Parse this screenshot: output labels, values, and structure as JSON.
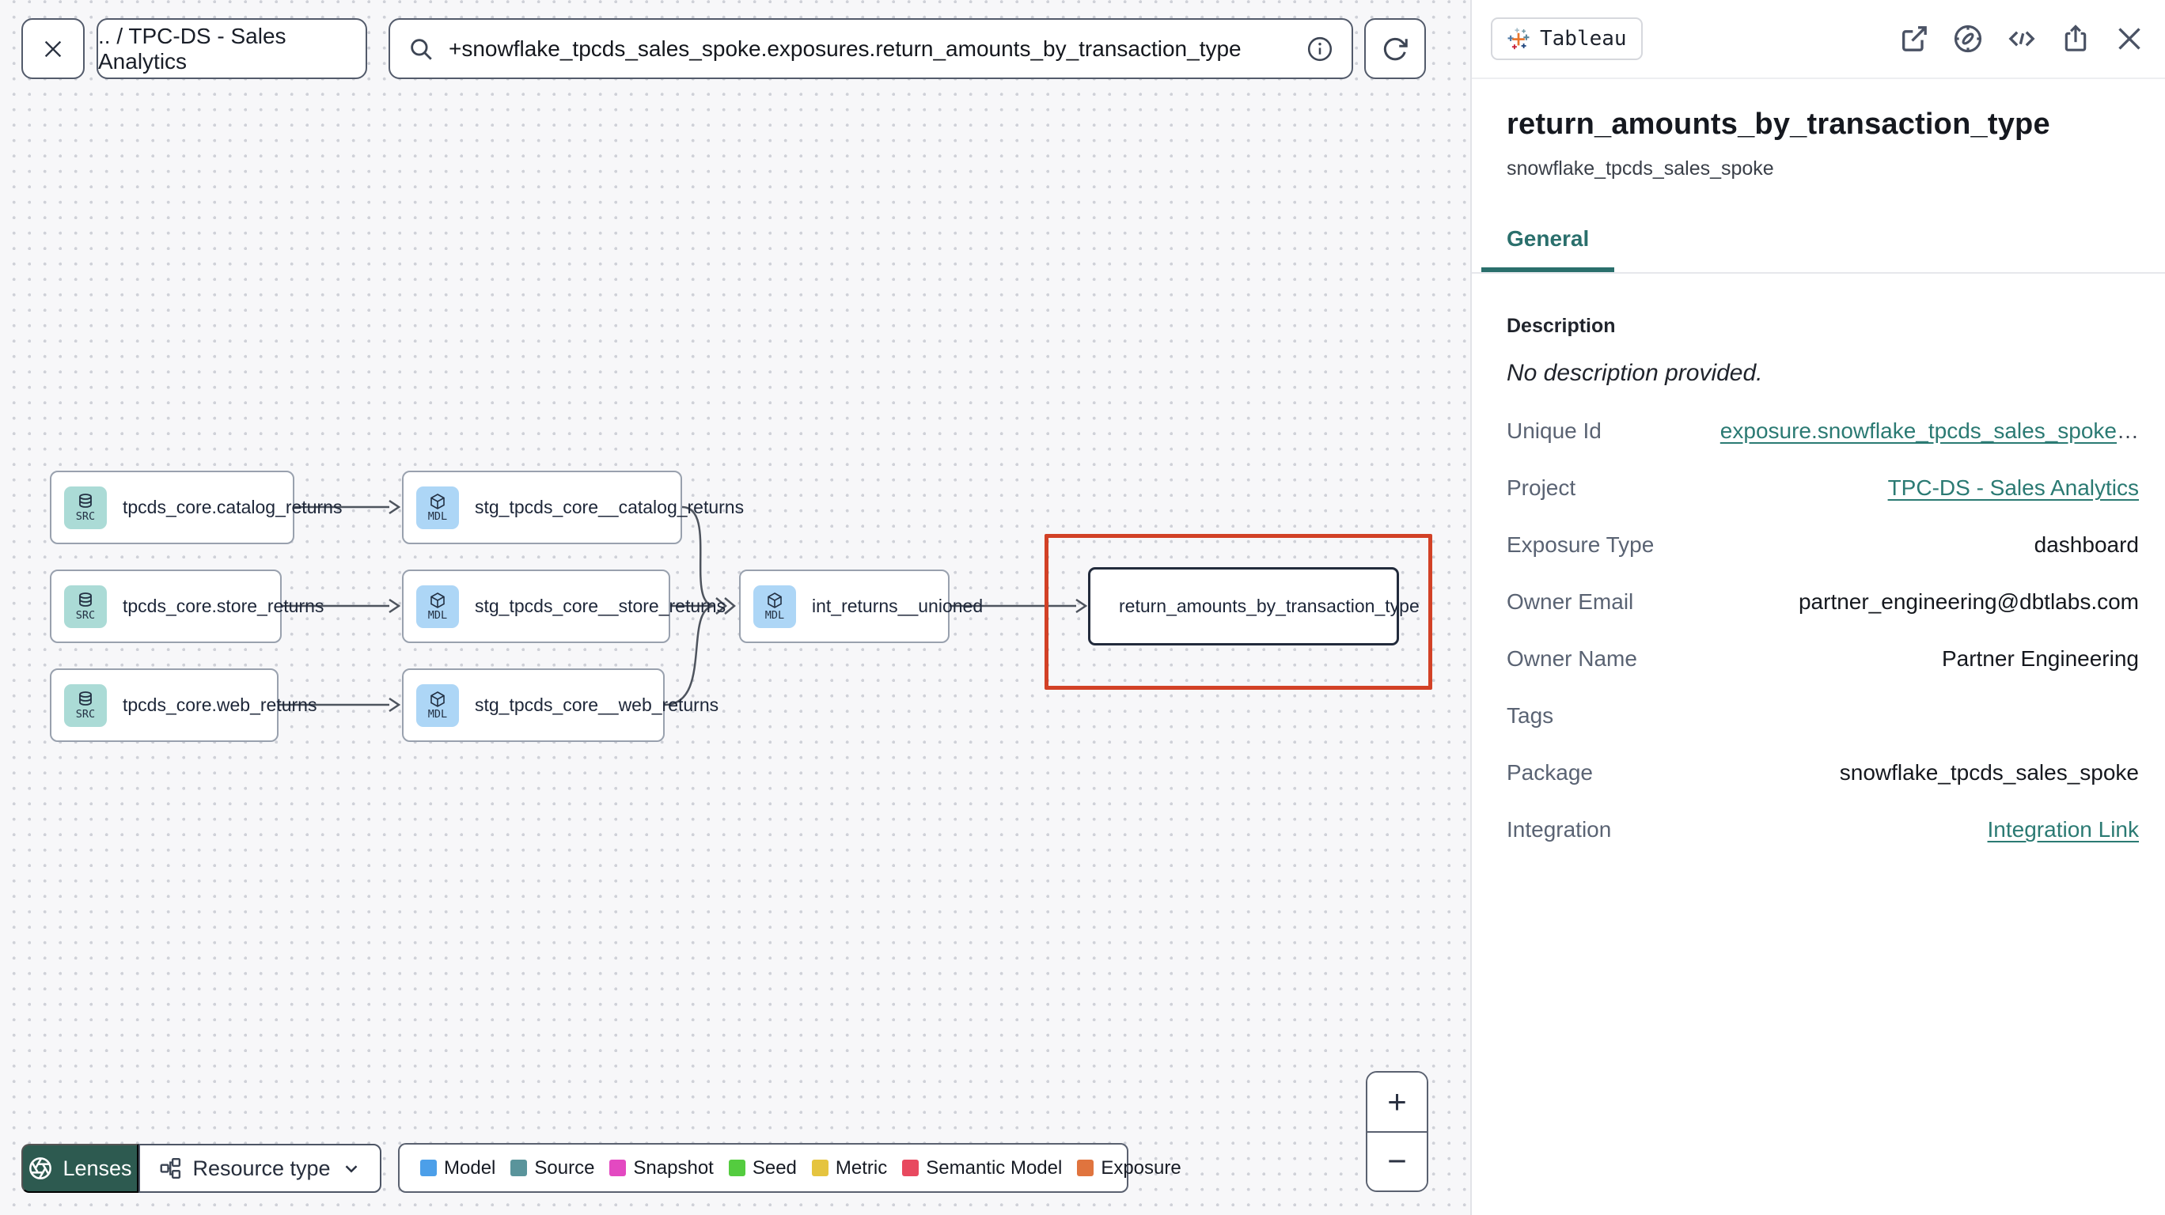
{
  "topbar": {
    "breadcrumb": ".. / TPC-DS - Sales Analytics",
    "search_value": "+snowflake_tpcds_sales_spoke.exposures.return_amounts_by_transaction_type"
  },
  "graph": {
    "nodes": [
      {
        "label": "tpcds_core.catalog_returns",
        "badge": "SRC",
        "type": "source"
      },
      {
        "label": "tpcds_core.store_returns",
        "badge": "SRC",
        "type": "source"
      },
      {
        "label": "tpcds_core.web_returns",
        "badge": "SRC",
        "type": "source"
      },
      {
        "label": "stg_tpcds_core__catalog_returns",
        "badge": "MDL",
        "type": "model"
      },
      {
        "label": "stg_tpcds_core__store_returns",
        "badge": "MDL",
        "type": "model"
      },
      {
        "label": "stg_tpcds_core__web_returns",
        "badge": "MDL",
        "type": "model"
      },
      {
        "label": "int_returns__unioned",
        "badge": "MDL",
        "type": "model"
      },
      {
        "label": "return_amounts_by_transaction_type",
        "type": "exposure"
      }
    ]
  },
  "toolbar": {
    "lenses_label": "Lenses",
    "resource_type_label": "Resource type"
  },
  "legend": {
    "items": [
      {
        "label": "Model",
        "color": "#4C9FE9"
      },
      {
        "label": "Source",
        "color": "#5A949B"
      },
      {
        "label": "Snapshot",
        "color": "#E349C1"
      },
      {
        "label": "Seed",
        "color": "#54CC3F"
      },
      {
        "label": "Metric",
        "color": "#E5C43F"
      },
      {
        "label": "Semantic Model",
        "color": "#E8495F"
      },
      {
        "label": "Exposure",
        "color": "#E0743E"
      }
    ]
  },
  "zoom_controls": {
    "zoom_in": "+",
    "zoom_out": "−"
  },
  "panel": {
    "integration_badge": "Tableau",
    "title": "return_amounts_by_transaction_type",
    "subtitle": "snowflake_tpcds_sales_spoke",
    "tab_general": "General",
    "description_label": "Description",
    "description_value": "No description provided.",
    "unique_id_ellipsis": "…",
    "fields": [
      {
        "label": "Unique Id",
        "value": "exposure.snowflake_tpcds_sales_spoke"
      },
      {
        "label": "Project",
        "value": "TPC-DS - Sales Analytics"
      },
      {
        "label": "Exposure Type",
        "value": "dashboard"
      },
      {
        "label": "Owner Email",
        "value": "partner_engineering@dbtlabs.com"
      },
      {
        "label": "Owner Name",
        "value": "Partner Engineering"
      },
      {
        "label": "Tags",
        "value": ""
      },
      {
        "label": "Package",
        "value": "snowflake_tpcds_sales_spoke"
      },
      {
        "label": "Integration",
        "value": "Integration Link"
      }
    ]
  },
  "colors": {
    "accent_teal": "#2A6F6C",
    "highlight_red": "#D24126",
    "lenses_green": "#2D5A50"
  }
}
